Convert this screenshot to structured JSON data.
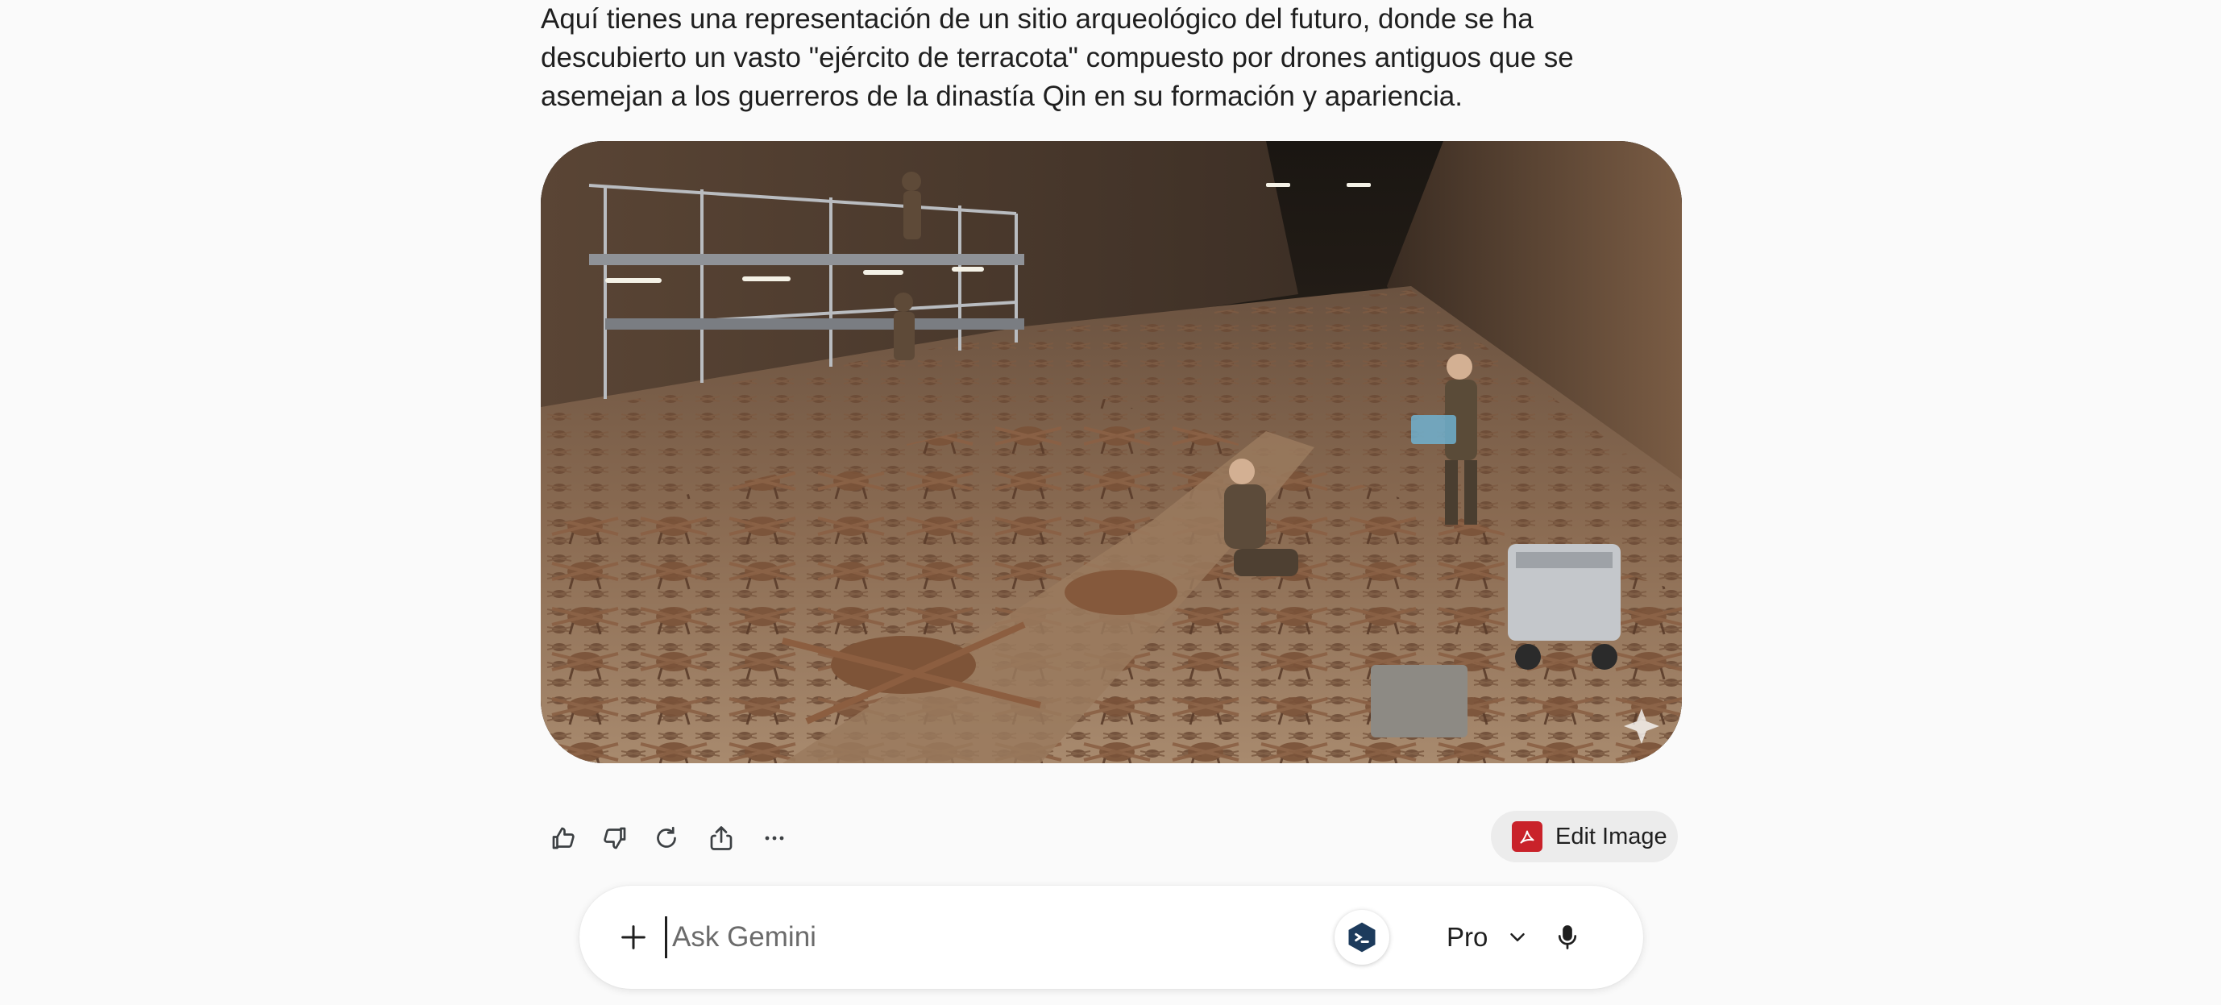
{
  "response": {
    "text": "Aquí tienes una representación de un sitio arqueológico del futuro, donde se ha descubierto un vasto \"ejército de terracota\" compuesto por drones antiguos que se asemejan a los guerreros de la dinastía Qin en su formación y apariencia."
  },
  "image": {
    "subject": "excavation site with rows of terracotta drones and archaeologists",
    "watermark_icon": "sparkle-icon"
  },
  "actions": {
    "icons": [
      "thumbs-up-icon",
      "thumbs-down-icon",
      "regenerate-icon",
      "share-icon",
      "more-icon"
    ],
    "edit_label": "Edit Image",
    "edit_icon": "acrobat-icon",
    "edit_icon_color": "#c9222a"
  },
  "input": {
    "placeholder": "Ask Gemini",
    "value": "",
    "model_label": "Pro"
  },
  "colors": {
    "background": "#fafafa",
    "text": "#1f1f1f",
    "edit_button_bg": "#ececec",
    "extension_badge": "#1d3b5c"
  }
}
